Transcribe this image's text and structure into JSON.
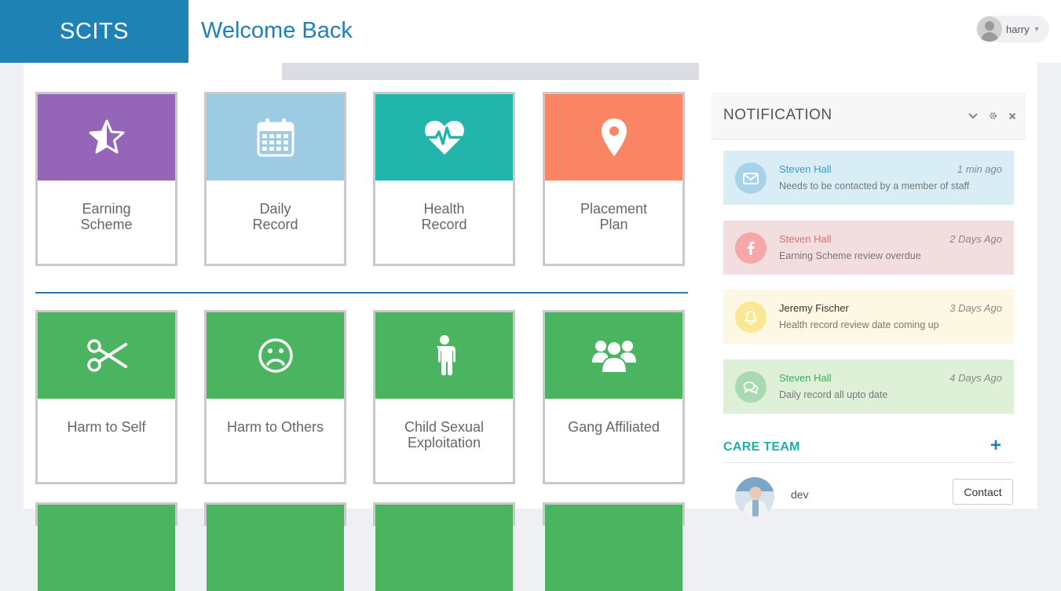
{
  "app": {
    "brand": "SCITS",
    "welcome": "Welcome Back",
    "user_name": "harry"
  },
  "tiles_row1": [
    {
      "label": "Earning\nScheme",
      "icon": "star-half-icon",
      "color": "#9566b7"
    },
    {
      "label": "Daily\nRecord",
      "icon": "calendar-icon",
      "color": "#9dcbe3"
    },
    {
      "label": "Health\nRecord",
      "icon": "heartbeat-icon",
      "color": "#21b5ac"
    },
    {
      "label": "Placement\nPlan",
      "icon": "map-marker-icon",
      "color": "#fa8564"
    }
  ],
  "tiles_row2": [
    {
      "label": "Harm to Self",
      "icon": "scissors-icon",
      "color": "#4ab461"
    },
    {
      "label": "Harm to Others",
      "icon": "frown-icon",
      "color": "#4ab461"
    },
    {
      "label": "Child Sexual\nExploitation",
      "icon": "male-icon",
      "color": "#4ab461"
    },
    {
      "label": "Gang Affiliated",
      "icon": "users-icon",
      "color": "#4ab461"
    }
  ],
  "notifications": {
    "title": "NOTIFICATION",
    "items": [
      {
        "name": "Steven Hall",
        "time": "1 min ago",
        "message": "Needs to be contacted by a member of staff",
        "icon": "envelope-icon",
        "bg": "#d9edf7",
        "icon_bg": "#a6d3e9",
        "name_color": "#3a9ccf"
      },
      {
        "name": "Steven Hall",
        "time": "2 Days Ago",
        "message": "Earning Scheme review overdue",
        "icon": "facebook-icon",
        "bg": "#f2dede",
        "icon_bg": "#f6a8a8",
        "name_color": "#ea6d6d"
      },
      {
        "name": "Jeremy Fischer",
        "time": "3 Days Ago",
        "message": "Health record review date coming up",
        "icon": "bell-icon",
        "bg": "#fcf8e3",
        "icon_bg": "#fae796",
        "name_color": "#333333"
      },
      {
        "name": "Steven Hall",
        "time": "4 Days Ago",
        "message": "Daily record all upto date",
        "icon": "comments-icon",
        "bg": "#dff0d8",
        "icon_bg": "#a7dab3",
        "name_color": "#3fae5b"
      }
    ]
  },
  "care_team": {
    "title": "CARE TEAM",
    "add_label": "+",
    "members": [
      {
        "name": "dev",
        "contact_label": "Contact"
      }
    ]
  }
}
